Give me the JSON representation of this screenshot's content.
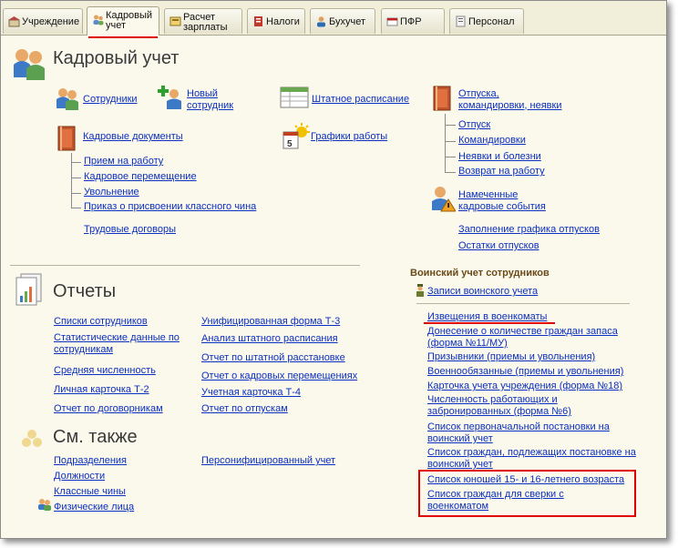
{
  "tabs": [
    {
      "label": "Учреждение",
      "icon": "institution-icon"
    },
    {
      "label": "Кадровый учет",
      "icon": "personnel-icon",
      "active": true
    },
    {
      "label": "Расчет зарплаты",
      "icon": "payroll-icon"
    },
    {
      "label": "Налоги",
      "icon": "taxes-icon"
    },
    {
      "label": "Бухучет",
      "icon": "accounting-icon"
    },
    {
      "label": "ПФР",
      "icon": "pension-fund-icon"
    },
    {
      "label": "Персонал",
      "icon": "staff-icon"
    }
  ],
  "tab_labels": {
    "t0": "Учреждение",
    "t1a": "Кадровый",
    "t1b": "учет",
    "t2a": "Расчет",
    "t2b": "зарплаты",
    "t3": "Налоги",
    "t4": "Бухучет",
    "t5": "ПФР",
    "t6": "Персонал"
  },
  "page_title": "Кадровый учет",
  "main": {
    "employees": "Сотрудники",
    "new_employee_a": "Новый",
    "new_employee_b": "сотрудник",
    "staffing": "Штатное расписание",
    "hr_docs": "Кадровые документы",
    "hr_docs_items": [
      "Прием на  работу",
      "Кадровое перемещение",
      "Увольнение",
      "Приказ о присвоении классного чина"
    ],
    "contracts": "Трудовые договоры",
    "schedules": "Графики  работы",
    "leaves_a": "Отпуска,",
    "leaves_b": "командировки, неявки",
    "leaves_items": [
      "Отпуск",
      "Командировки",
      "Неявки и болезни",
      "Возврат на работу"
    ],
    "planned_a": "Намеченные",
    "planned_b": "кадровые события",
    "fill_schedule": "Заполнение графика отпусков",
    "leave_balance": "Остатки отпусков"
  },
  "reports": {
    "title": "Отчеты",
    "left": [
      "Списки сотрудников",
      "Статистические данные по",
      "сотрудникам",
      "Средняя численность",
      "Личная карточка Т-2",
      "Отчет по договорникам"
    ],
    "right": [
      "Унифицированная форма Т-3",
      "Анализ штатного расписания",
      "Отчет по штатной расстановке",
      "Отчет о кадровых перемещениях",
      "Учетная карточка Т-4",
      "Отчет по отпускам"
    ]
  },
  "see_also": {
    "title": "См. также",
    "left": [
      "Подразделения",
      "Должности",
      "Классные чины",
      "Физические лица"
    ],
    "right": [
      "Персонифицированный учет"
    ]
  },
  "military": {
    "title": "Воинский учет сотрудников",
    "records": "Записи воинского учета",
    "items": [
      "Извещения в военкоматы",
      "Донесение о количестве граждан запаса",
      "(форма №11/МУ)",
      "Призывники (приемы и увольнения)",
      "Военнообязанные (приемы и увольнения)",
      "Карточка учета учреждения (форма №18)",
      "Численность работающих и",
      "забронированных (форма №6)",
      "Список первоначальной постановки на",
      "воинский учет",
      "Список граждан, подлежащих постановке на",
      "воинский учет",
      "Список юношей 15- и 16-летнего возраста",
      "Список граждан для сверки с",
      "военкоматом"
    ]
  },
  "colors": {
    "link": "#0b2fc0",
    "highlight": "#e00000",
    "background": "#fbf9ec",
    "section_title": "#6a4a18"
  }
}
